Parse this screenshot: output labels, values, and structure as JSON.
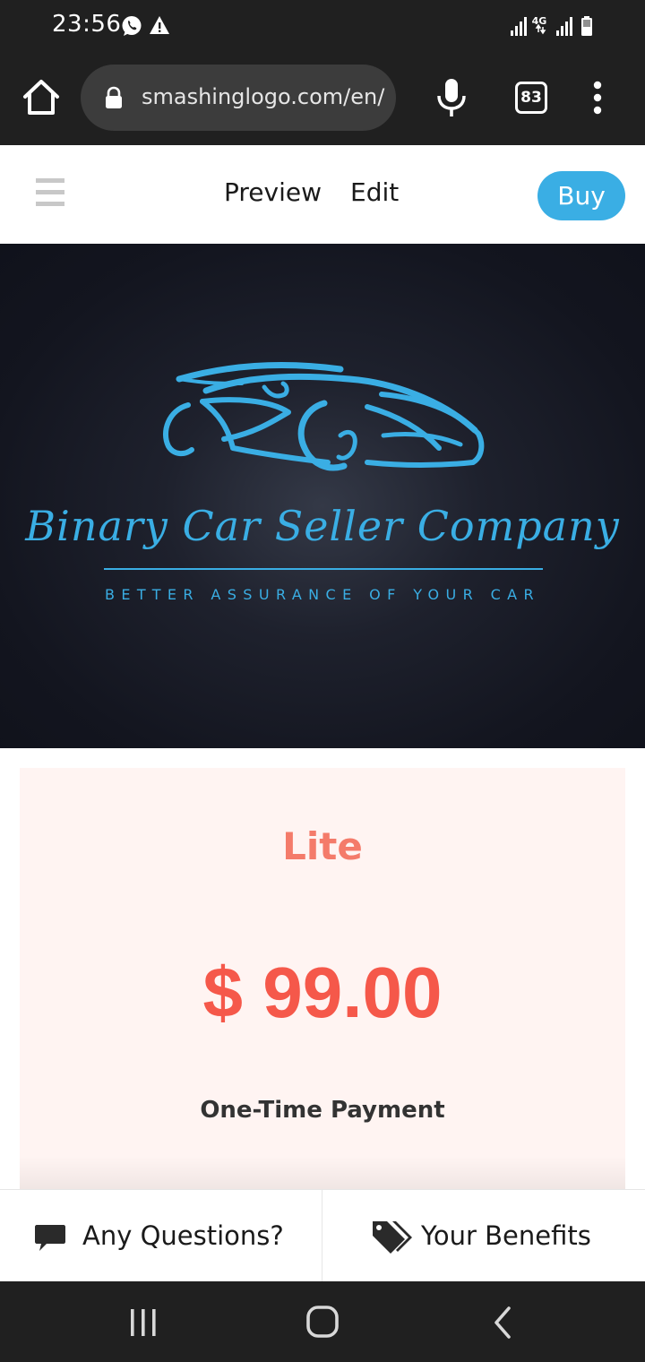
{
  "status_bar": {
    "time": "23:56",
    "network_label": "4G",
    "icons": [
      "whatsapp-icon",
      "warning-icon",
      "signal-icon",
      "battery-icon"
    ]
  },
  "browser": {
    "url": "smashinglogo.com/en/cl",
    "tab_count": "83",
    "icons": [
      "home-icon",
      "lock-icon",
      "microphone-icon",
      "more-vert-icon"
    ]
  },
  "site_header": {
    "nav": {
      "preview": "Preview",
      "edit": "Edit"
    },
    "buy_label": "Buy",
    "menu_icon": "hamburger-icon"
  },
  "logo": {
    "company_name": "Binary Car Seller Company",
    "tagline": "BETTER ASSURANCE OF YOUR CAR",
    "logo_color": "#3aaee4",
    "background_color": "#1a1d28"
  },
  "pricing": {
    "plan_name": "Lite",
    "price": "$ 99.00",
    "payment_type": "One-Time Payment",
    "plan_color": "#f47b6a",
    "price_color": "#f5584a",
    "card_background": "#fff4f2"
  },
  "bottom_actions": {
    "questions_label": "Any Questions?",
    "benefits_label": "Your Benefits",
    "icons": [
      "chat-icon",
      "tags-icon"
    ]
  },
  "nav_bar": {
    "icons": [
      "recents-icon",
      "home-nav-icon",
      "back-icon"
    ]
  }
}
